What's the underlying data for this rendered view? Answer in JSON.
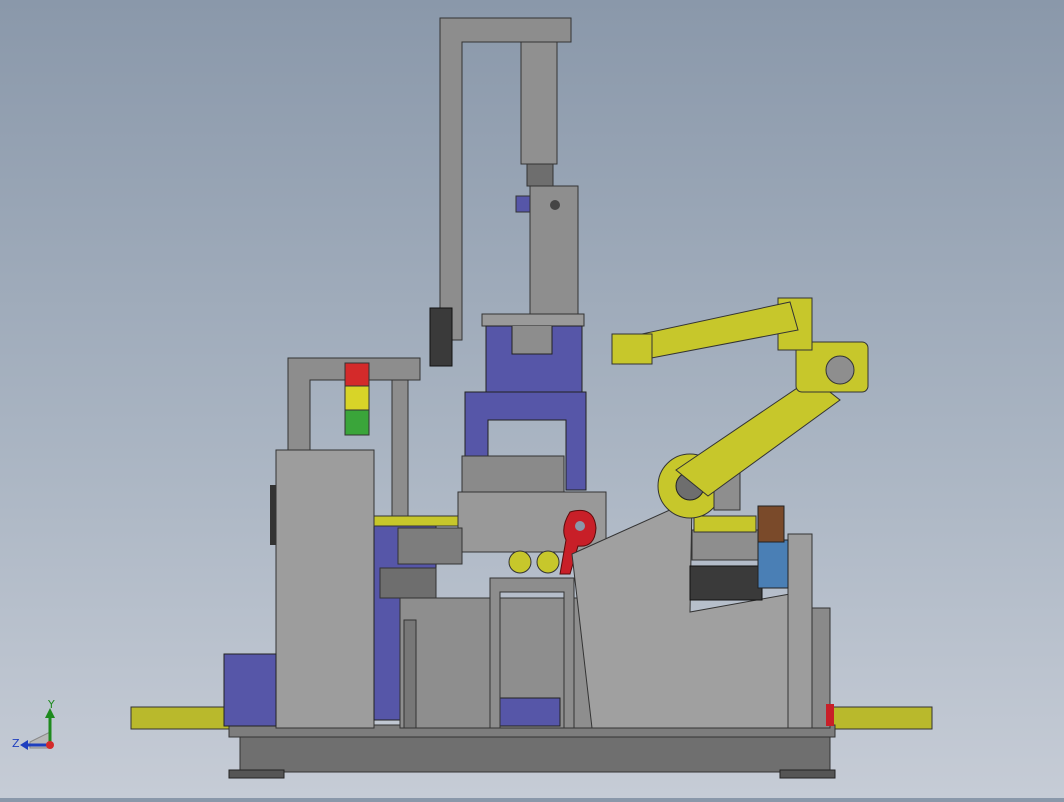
{
  "triad": {
    "x_label": "",
    "y_label": "Y",
    "z_label": "Z"
  },
  "stack_light": {
    "colors": [
      "#d42a2a",
      "#d8d428",
      "#3aa53a"
    ]
  },
  "colors": {
    "frame_gray": "#8d8d8d",
    "machine_blue": "#5656a8",
    "robot_yellow": "#c7c72b",
    "accent_red": "#c81f28",
    "base_yellow": "#b9b92c"
  }
}
